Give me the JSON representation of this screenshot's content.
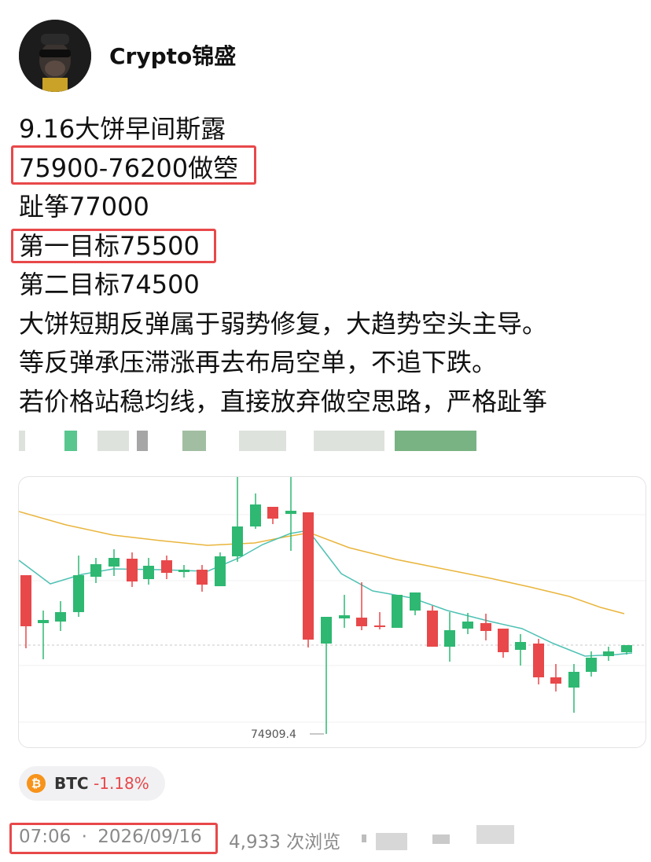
{
  "author": {
    "name": "Crypto锦盛"
  },
  "post": {
    "lines": [
      "9.16大饼早间斯露",
      "75900-76200做箜",
      "趾筝77000",
      "第一目标75500",
      "第二目标74500",
      "大饼短期反弹属于弱势修复，大趋势空头主导。",
      "等反弹承压滞涨再去布局空单，不追下跌。",
      "若价格站稳均线，直接放弃做空思路，严格趾筝"
    ]
  },
  "chart": {
    "low_label": "74909.4",
    "colors": {
      "up": "#2eb872",
      "down": "#e8484a",
      "ma_fast": "#4fc1b4",
      "ma_slow": "#e9b53c"
    }
  },
  "ticker": {
    "symbol": "BTC",
    "coin_glyph": "₿",
    "change": "-1.18%"
  },
  "meta": {
    "time": "07:06",
    "separator": "·",
    "date": "2026/09/16",
    "views": "4,933 次浏览"
  }
}
